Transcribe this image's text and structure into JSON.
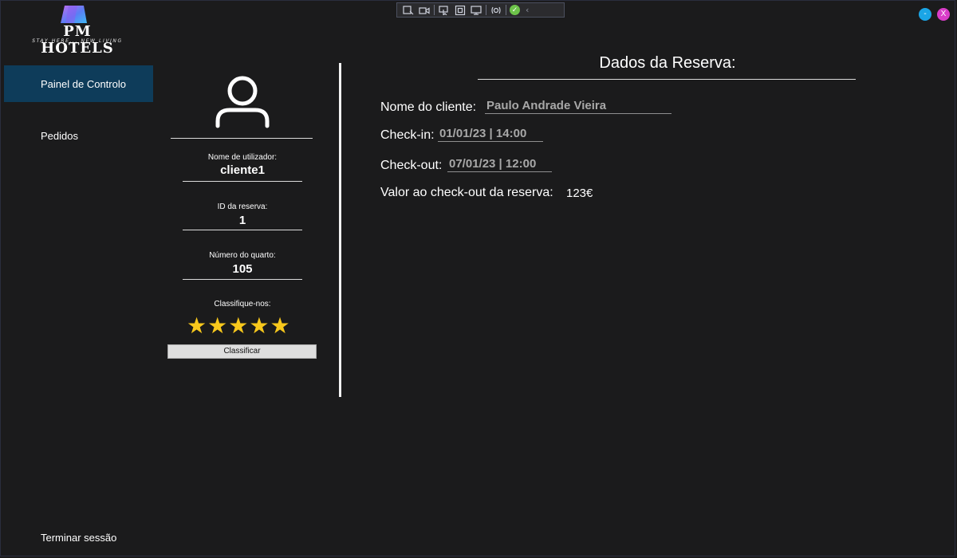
{
  "window": {
    "minimize_label": "-",
    "close_label": "X"
  },
  "colors": {
    "accent_blue": "#1aa5e6",
    "accent_pink": "#d93dc8",
    "nav_active": "#0e3c5a",
    "star": "#f8c81c"
  },
  "logo": {
    "title": "PM HOTELS",
    "tagline": "STAY HERE... NEW LIVING"
  },
  "nav": {
    "items": [
      {
        "label": "Painel de Controlo",
        "active": true
      },
      {
        "label": "Pedidos",
        "active": false
      }
    ],
    "logout_label": "Terminar sessão"
  },
  "profile": {
    "avatar_icon": "user-icon",
    "username_label": "Nome de utilizador:",
    "username": "cliente1",
    "reservation_id_label": "ID da reserva:",
    "reservation_id": "1",
    "room_label": "Número do quarto:",
    "room": "105",
    "rating_label": "Classifique-nos:",
    "rating": 5,
    "rating_max": 5,
    "rate_button": "Classificar"
  },
  "reservation": {
    "title": "Dados da Reserva:",
    "client_label": "Nome do cliente:",
    "client_value": "Paulo Andrade Vieira",
    "checkin_label": "Check-in:",
    "checkin_value": "01/01/23 | 14:00",
    "checkout_label": "Check-out:",
    "checkout_value": "07/01/23 | 12:00",
    "price_label": "Valor ao check-out da reserva:",
    "price_value": "123€"
  }
}
